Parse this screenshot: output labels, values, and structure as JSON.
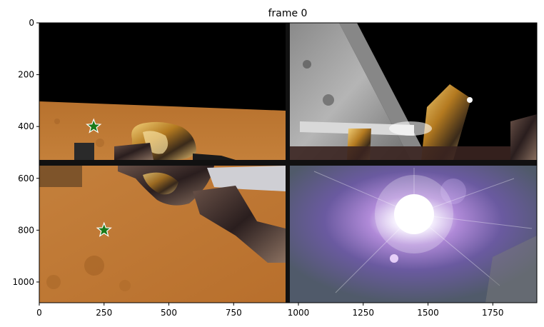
{
  "title": "frame 0",
  "axes": {
    "xlim": [
      0,
      1920
    ],
    "ylim": [
      1080,
      0
    ],
    "x_ticks": [
      0,
      250,
      500,
      750,
      1000,
      1250,
      1500,
      1750
    ],
    "y_ticks": [
      0,
      200,
      400,
      600,
      800,
      1000
    ]
  },
  "markers": [
    {
      "label": "star-marker-top",
      "x": 210,
      "y": 400,
      "color": "#1a7a1a"
    },
    {
      "label": "star-marker-bottom",
      "x": 250,
      "y": 800,
      "color": "#1a7a1a"
    }
  ],
  "panels": [
    {
      "name": "panel-top-left",
      "scene": "mars-surface-with-spacecraft"
    },
    {
      "name": "panel-top-right",
      "scene": "moon-surface-with-lander-leg"
    },
    {
      "name": "panel-bottom-left",
      "scene": "mars-surface-closeup"
    },
    {
      "name": "panel-bottom-right",
      "scene": "sun-glare-lens-flare"
    }
  ]
}
